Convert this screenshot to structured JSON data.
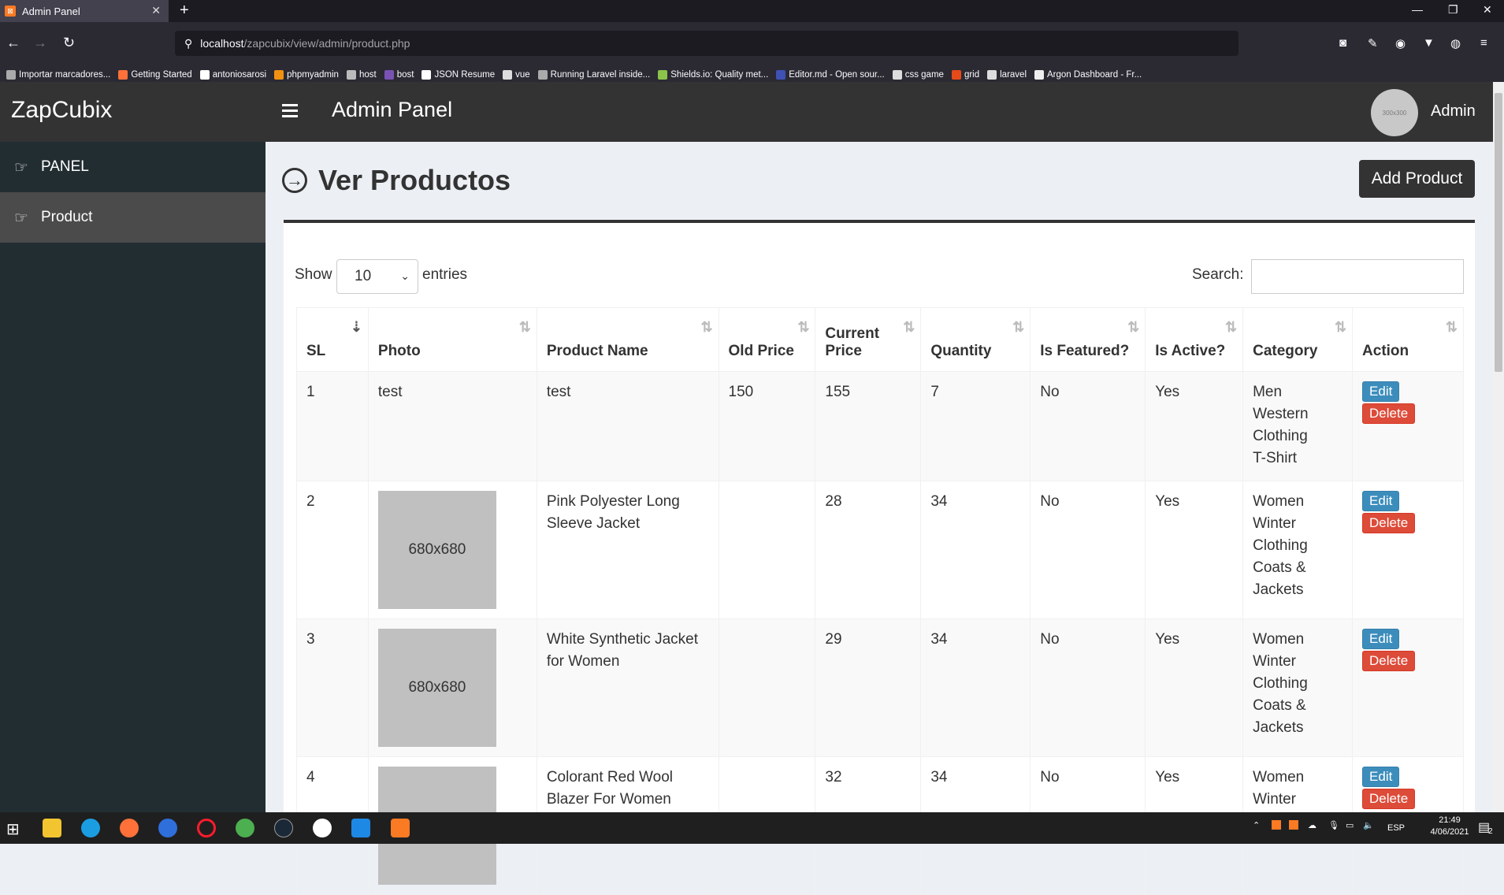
{
  "browser": {
    "tab_title": "Admin Panel",
    "tab_favicon": "xampp-icon",
    "url_host": "localhost",
    "url_path": "/zapcubix/view/admin/product.php",
    "bookmarks": [
      "Importar marcadores...",
      "Getting Started",
      "antoniosarosi",
      "phpmyadmin",
      "host",
      "bost",
      "JSON Resume",
      "vue",
      "Running Laravel inside...",
      "Shields.io: Quality met...",
      "Editor.md - Open sour...",
      "css game",
      "grid",
      "laravel",
      "Argon Dashboard - Fr..."
    ]
  },
  "header": {
    "brand": "ZapCubix",
    "title": "Admin Panel",
    "avatar_text": "300x300",
    "user": "Admin"
  },
  "sidebar": {
    "items": [
      {
        "label": "PANEL",
        "icon": "hand-pointing-icon"
      },
      {
        "label": "Product",
        "icon": "hand-pointing-icon"
      }
    ]
  },
  "page": {
    "heading": "Ver Productos",
    "add_button": "Add Product",
    "show_label": "Show",
    "entries_value": "10",
    "entries_label": "entries",
    "search_label": "Search:"
  },
  "table": {
    "columns": [
      "SL",
      "Photo",
      "Product Name",
      "Old Price",
      "Current Price",
      "Quantity",
      "Is Featured?",
      "Is Active?",
      "Category",
      "Action"
    ],
    "rows": [
      {
        "sl": "1",
        "photo": "test",
        "photo_is_image": false,
        "name": "test",
        "old_price": "150",
        "current_price": "155",
        "quantity": "7",
        "featured": "No",
        "active": "Yes",
        "category": "Men\nWestern\nClothing\nT-Shirt"
      },
      {
        "sl": "2",
        "photo": "680x680",
        "photo_is_image": true,
        "name": "Pink Polyester Long Sleeve Jacket",
        "old_price": "",
        "current_price": "28",
        "quantity": "34",
        "featured": "No",
        "active": "Yes",
        "category": "Women\nWinter\nClothing\nCoats &\nJackets"
      },
      {
        "sl": "3",
        "photo": "680x680",
        "photo_is_image": true,
        "name": "White Synthetic Jacket for Women",
        "old_price": "",
        "current_price": "29",
        "quantity": "34",
        "featured": "No",
        "active": "Yes",
        "category": "Women\nWinter\nClothing\nCoats &\nJackets"
      },
      {
        "sl": "4",
        "photo": "",
        "photo_is_image": true,
        "name": "Colorant Red Wool Blazer For Women",
        "old_price": "",
        "current_price": "32",
        "quantity": "34",
        "featured": "No",
        "active": "Yes",
        "category": "Women\nWinter"
      }
    ],
    "edit_label": "Edit",
    "delete_label": "Delete"
  },
  "taskbar": {
    "time": "21:49",
    "date": "4/06/2021",
    "lang": "ESP",
    "notifications": "2"
  },
  "colors": {
    "header_bg": "#333333",
    "sidebar_bg": "#222d32",
    "sidebar_active": "#4b4b4b",
    "edit_btn": "#3c8dbc",
    "delete_btn": "#dd4b39"
  }
}
